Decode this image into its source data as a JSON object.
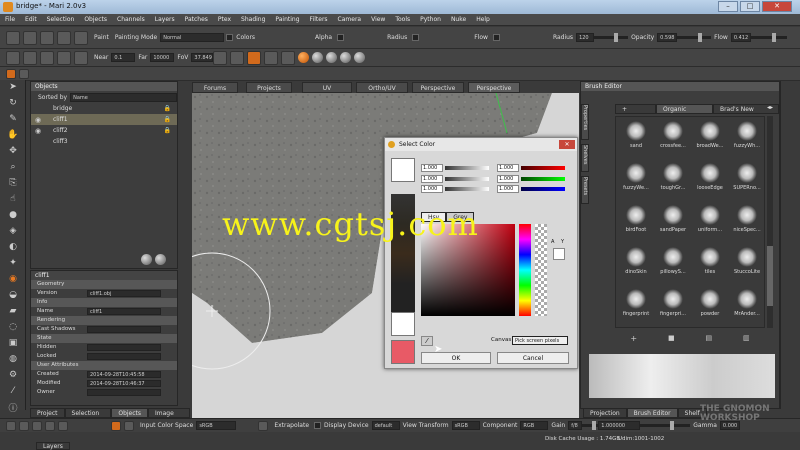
{
  "window": {
    "title": "bridge* - Mari 2.0v3"
  },
  "menu": [
    "File",
    "Edit",
    "Selection",
    "Objects",
    "Channels",
    "Layers",
    "Patches",
    "Ptex",
    "Shading",
    "Painting",
    "Filters",
    "Camera",
    "View",
    "Tools",
    "Python",
    "Nuke",
    "Help"
  ],
  "toolbar1": {
    "paint": "Paint",
    "painting_mode_label": "Painting Mode",
    "painting_mode_value": "Normal",
    "colors": "Colors",
    "alpha": "Alpha",
    "radius": "Radius",
    "flow": "Flow",
    "radius2": "Radius",
    "radius_value": "120",
    "opacity": "Opacity",
    "opacity_value": "0.598",
    "flow2": "Flow",
    "flow_value": "0.412"
  },
  "toolbar2": {
    "near": "Near",
    "near_value": "0.1",
    "far": "Far",
    "far_value": "10000",
    "fov": "FoV",
    "fov_value": "37.849"
  },
  "objects": {
    "title": "Objects",
    "sorted_by_label": "Sorted by",
    "sorted_by_value": "Name",
    "items": [
      "bridge",
      "cliff1",
      "cliff2",
      "cliff3"
    ]
  },
  "properties": {
    "object_name": "cliff1",
    "rows": [
      {
        "label": "Geometry",
        "value": "",
        "section": true
      },
      {
        "label": "Version",
        "value": "cliff1.obj",
        "section": false
      },
      {
        "label": "Info",
        "value": "",
        "section": true
      },
      {
        "label": "Name",
        "value": "cliff1",
        "section": false
      },
      {
        "label": "Rendering",
        "value": "",
        "section": true
      },
      {
        "label": "Cast Shadows",
        "value": "",
        "section": false
      },
      {
        "label": "State",
        "value": "",
        "section": true
      },
      {
        "label": "Hidden",
        "value": "",
        "section": false
      },
      {
        "label": "Locked",
        "value": "",
        "section": false
      },
      {
        "label": "User Attributes",
        "value": "",
        "section": true
      },
      {
        "label": "Created",
        "value": "2014-09-28T10:45:58",
        "section": false
      },
      {
        "label": "Modified",
        "value": "2014-09-28T10:46:37",
        "section": false
      },
      {
        "label": "Owner",
        "value": "",
        "section": false
      }
    ]
  },
  "left_tabs": [
    "Project",
    "Selection Gro...",
    "Objects",
    "Image Man..."
  ],
  "view_tabs": [
    "Forums",
    "Projects",
    "UV",
    "Ortho/UV",
    "Perspective",
    "Perspective"
  ],
  "color_dialog": {
    "title": "Select Color",
    "channels": [
      "1.000",
      "1.000",
      "1.000",
      "1.000",
      "1.000",
      "1.000"
    ],
    "tabs": [
      "Hsv",
      "Grey"
    ],
    "canvas_label": "Canvas",
    "canvas_value": "Pick screen pixels",
    "ok": "OK",
    "cancel": "Cancel",
    "alpha_label": "A",
    "y_label": "Y"
  },
  "brush_editor": {
    "title": "Brush Editor",
    "tabs": [
      "+ Brushes",
      "Organic Brushes",
      "Brad's New Brushes"
    ],
    "side_tabs": [
      "Properties",
      "Shelves",
      "Presets"
    ],
    "brushes": [
      [
        "sand",
        "crossfee...",
        "broadWe...",
        "fuzzyWh..."
      ],
      [
        "fuzzyWe...",
        "toughGr...",
        "looseEdge",
        "SUPERno..."
      ],
      [
        "birdFoot",
        "sandPaper",
        "uniform...",
        "niceSpec..."
      ],
      [
        "dinoSkin",
        "pillowyS...",
        "tiles",
        "StuccoLite"
      ],
      [
        "fingerprint",
        "fingerpri...",
        "powder",
        "MrAnder..."
      ]
    ],
    "bottom_tabs": [
      "Projection",
      "Brush Editor",
      "Shelf"
    ]
  },
  "bottombar": {
    "input_color_space_label": "Input Color Space",
    "input_color_space_value": "sRGB",
    "extrapolate": "Extrapolate",
    "display_device_label": "Display Device",
    "display_device_value": "default",
    "view_transform_label": "View Transform",
    "view_transform_value": "sRGB",
    "component_label": "Component",
    "component_value": "RGB",
    "gain_label": "Gain",
    "gain_value": "f/8",
    "gain_num": "1.000000",
    "gamma_label": "Gamma",
    "gamma_value": "0.000"
  },
  "status": {
    "disk": "Disk Cache Usage : 1.74GB",
    "udim": "Udim:1001-1002",
    "layers_tab": "Layers"
  },
  "watermark": "www.cgtsj.com",
  "brand": {
    "line1": "THE GNOMON",
    "line2": "WORKSHOP"
  },
  "colors": {
    "accent": "#e07a22",
    "watermark": "#f7f31a",
    "selection": "#6e6a56"
  }
}
